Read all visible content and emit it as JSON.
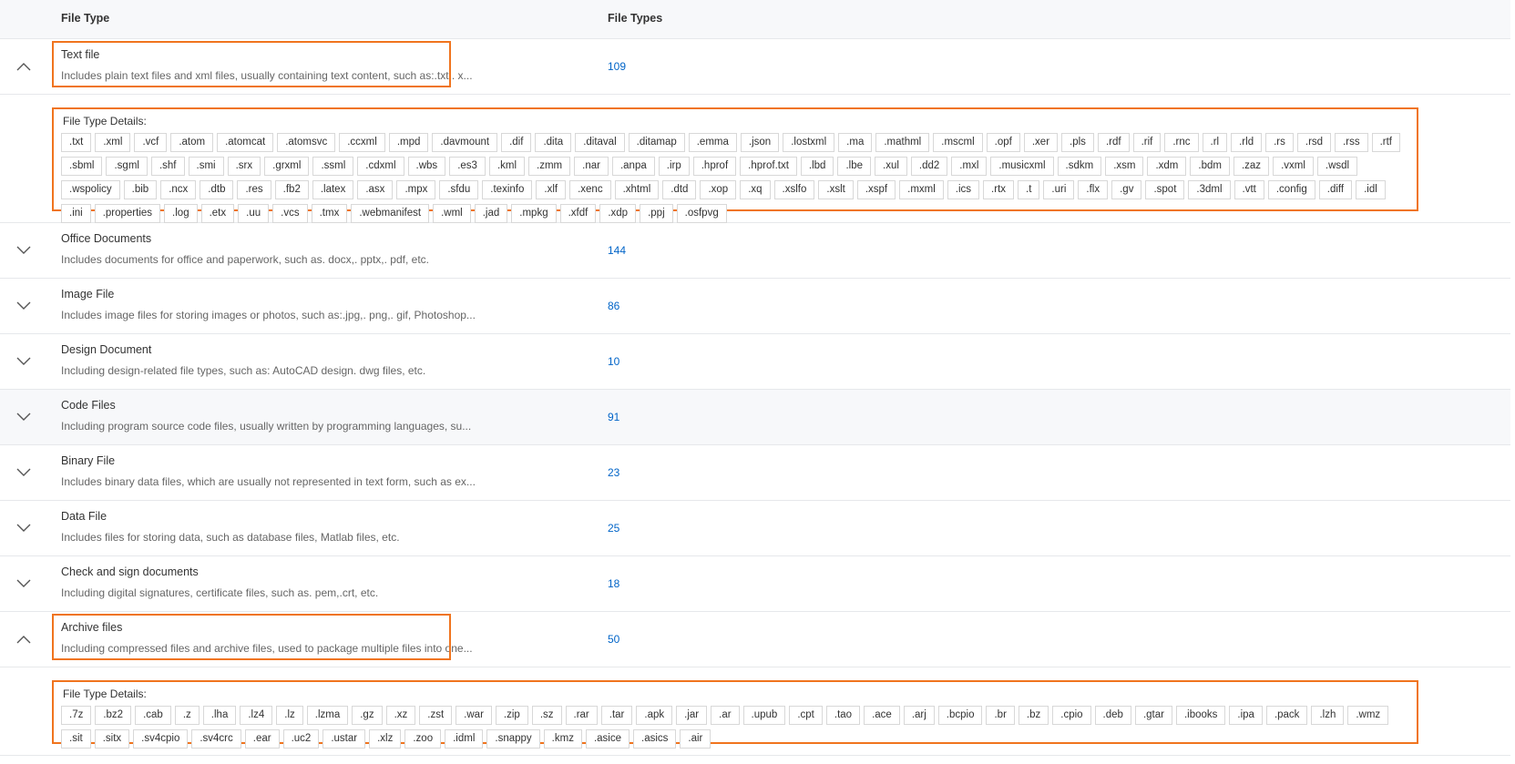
{
  "header": {
    "col_type": "File Type",
    "col_count": "File Types"
  },
  "details_label": "File Type Details:",
  "rows": [
    {
      "title": "Text file",
      "desc": "Includes plain text files and xml files, usually containing text content, such as:.txt,. x...",
      "count": "109",
      "expanded": true,
      "tags": [
        ".txt",
        ".xml",
        ".vcf",
        ".atom",
        ".atomcat",
        ".atomsvc",
        ".ccxml",
        ".mpd",
        ".davmount",
        ".dif",
        ".dita",
        ".ditaval",
        ".ditamap",
        ".emma",
        ".json",
        ".lostxml",
        ".ma",
        ".mathml",
        ".mscml",
        ".opf",
        ".xer",
        ".pls",
        ".rdf",
        ".rif",
        ".rnc",
        ".rl",
        ".rld",
        ".rs",
        ".rsd",
        ".rss",
        ".rtf",
        ".sbml",
        ".sgml",
        ".shf",
        ".smi",
        ".srx",
        ".grxml",
        ".ssml",
        ".cdxml",
        ".wbs",
        ".es3",
        ".kml",
        ".zmm",
        ".nar",
        ".anpa",
        ".irp",
        ".hprof",
        ".hprof.txt",
        ".lbd",
        ".lbe",
        ".xul",
        ".dd2",
        ".mxl",
        ".musicxml",
        ".sdkm",
        ".xsm",
        ".xdm",
        ".bdm",
        ".zaz",
        ".vxml",
        ".wsdl",
        ".wspolicy",
        ".bib",
        ".ncx",
        ".dtb",
        ".res",
        ".fb2",
        ".latex",
        ".asx",
        ".mpx",
        ".sfdu",
        ".texinfo",
        ".xlf",
        ".xenc",
        ".xhtml",
        ".dtd",
        ".xop",
        ".xq",
        ".xslfo",
        ".xslt",
        ".xspf",
        ".mxml",
        ".ics",
        ".rtx",
        ".t",
        ".uri",
        ".flx",
        ".gv",
        ".spot",
        ".3dml",
        ".vtt",
        ".config",
        ".diff",
        ".idl",
        ".ini",
        ".properties",
        ".log",
        ".etx",
        ".uu",
        ".vcs",
        ".tmx",
        ".webmanifest",
        ".wml",
        ".jad",
        ".mpkg",
        ".xfdf",
        ".xdp",
        ".ppj",
        ".osfpvg"
      ]
    },
    {
      "title": "Office Documents",
      "desc": "Includes documents for office and paperwork, such as. docx,. pptx,. pdf, etc.",
      "count": "144",
      "expanded": false
    },
    {
      "title": "Image File",
      "desc": "Includes image files for storing images or photos, such as:.jpg,. png,. gif, Photoshop...",
      "count": "86",
      "expanded": false
    },
    {
      "title": "Design Document",
      "desc": "Including design-related file types, such as: AutoCAD design. dwg files, etc.",
      "count": "10",
      "expanded": false
    },
    {
      "title": "Code Files",
      "desc": "Including program source code files, usually written by programming languages, su...",
      "count": "91",
      "expanded": false,
      "hover": true
    },
    {
      "title": "Binary File",
      "desc": "Includes binary data files, which are usually not represented in text form, such as ex...",
      "count": "23",
      "expanded": false
    },
    {
      "title": "Data File",
      "desc": "Includes files for storing data, such as database files, Matlab files, etc.",
      "count": "25",
      "expanded": false
    },
    {
      "title": "Check and sign documents",
      "desc": "Including digital signatures, certificate files, such as. pem,.crt, etc.",
      "count": "18",
      "expanded": false
    },
    {
      "title": "Archive files",
      "desc": "Including compressed files and archive files, used to package multiple files into one...",
      "count": "50",
      "expanded": true,
      "tags": [
        ".7z",
        ".bz2",
        ".cab",
        ".z",
        ".lha",
        ".lz4",
        ".lz",
        ".lzma",
        ".gz",
        ".xz",
        ".zst",
        ".war",
        ".zip",
        ".sz",
        ".rar",
        ".tar",
        ".apk",
        ".jar",
        ".ar",
        ".upub",
        ".cpt",
        ".tao",
        ".ace",
        ".arj",
        ".bcpio",
        ".br",
        ".bz",
        ".cpio",
        ".deb",
        ".gtar",
        ".ibooks",
        ".ipa",
        ".pack",
        ".lzh",
        ".wmz",
        ".sit",
        ".sitx",
        ".sv4cpio",
        ".sv4crc",
        ".ear",
        ".uc2",
        ".ustar",
        ".xlz",
        ".zoo",
        ".idml",
        ".snappy",
        ".kmz",
        ".asice",
        ".asics",
        ".air"
      ]
    }
  ]
}
